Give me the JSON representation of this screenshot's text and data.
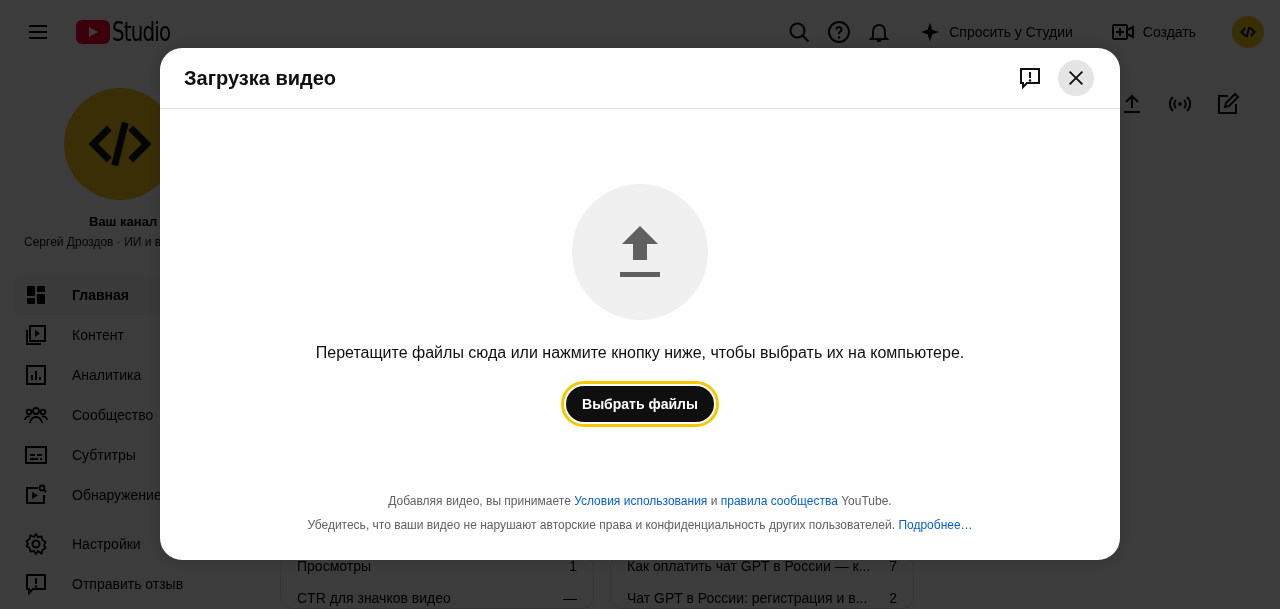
{
  "header": {
    "logo_text": "Studio",
    "ask_button": "Спросить у Студии",
    "create_button": "Создать"
  },
  "sidebar": {
    "channel_label": "Ваш канал",
    "channel_name": "Сергей Дроздов · ИИ и в",
    "items": [
      {
        "kind": "dashboard",
        "label": "Главная",
        "selected": true
      },
      {
        "kind": "content",
        "label": "Контент",
        "selected": false
      },
      {
        "kind": "analytics",
        "label": "Аналитика",
        "selected": false
      },
      {
        "kind": "community",
        "label": "Сообщество",
        "selected": false
      },
      {
        "kind": "subtitles",
        "label": "Субтитры",
        "selected": false
      },
      {
        "kind": "discovery",
        "label": "Обнаружение",
        "selected": false
      },
      {
        "kind": "settings",
        "label": "Настройки",
        "selected": false
      },
      {
        "kind": "feedback",
        "label": "Отправить отзыв",
        "selected": false
      }
    ]
  },
  "main": {
    "metrics": [
      {
        "label": "Просмотры",
        "value": "1"
      },
      {
        "label": "CTR для значков видео",
        "value": "—"
      }
    ],
    "top_videos": [
      {
        "title": "Как оплатить чат GPT в России — к...",
        "views": "7"
      },
      {
        "title": "Чат GPT в России: регистрация и в...",
        "views": "2"
      }
    ]
  },
  "dialog": {
    "title": "Загрузка видео",
    "prompt": "Перетащите файлы сюда или нажмите кнопку ниже, чтобы выбрать их на компьютере.",
    "select_button": "Выбрать файлы",
    "footer_lines": [
      [
        {
          "kind": "text",
          "text": "Добавляя видео, вы принимаете "
        },
        {
          "kind": "link",
          "text": "Условия использования"
        },
        {
          "kind": "text",
          "text": " и "
        },
        {
          "kind": "link",
          "text": "правила сообщества"
        },
        {
          "kind": "text",
          "text": " YouTube."
        }
      ],
      [
        {
          "kind": "text",
          "text": "Убедитесь, что ваши видео не нарушают авторские права и конфиденциальность других пользователей. "
        },
        {
          "kind": "link",
          "text": "Подробнее…"
        }
      ]
    ]
  }
}
